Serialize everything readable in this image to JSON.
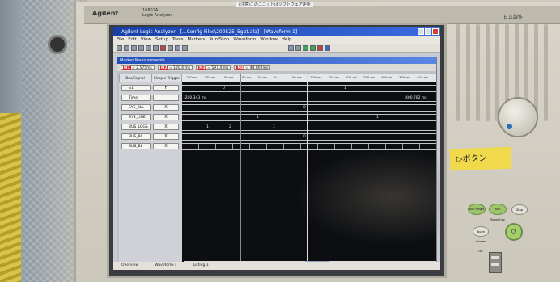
{
  "device": {
    "brand": "Agilent",
    "model_line1": "16802A",
    "model_line2": "Logic Analyzer",
    "maker_label": "日立製作",
    "top_sticker": "(注意)このユニットはソフトウェア更新"
  },
  "window": {
    "title": "Agilent Logic Analyzer - [...Config Files\\200525_5gpt.ala] - [Waveform-1]",
    "menu": [
      "File",
      "Edit",
      "View",
      "Setup",
      "Tools",
      "Markers",
      "Run/Stop",
      "Waveform",
      "Window",
      "Help"
    ]
  },
  "subwindow": {
    "title": "Marker Measurements",
    "markers": [
      {
        "id": "M1",
        "to": "M2",
        "value": "= 2.575ms"
      },
      {
        "id": "M2",
        "to": "M3",
        "value": "= 120.4 ms"
      },
      {
        "id": "M3",
        "to": "M4",
        "value": "= 597.4 ms"
      },
      {
        "id": "M4",
        "to": "M5",
        "value": "= 44.802ms"
      }
    ]
  },
  "panel": {
    "col_bus": "Bus/Signal",
    "col_trigger": "Simple Trigger"
  },
  "signals": [
    {
      "name": "S1",
      "trigger": "F",
      "wave": [
        "0",
        "",
        "1"
      ]
    },
    {
      "name": "Time",
      "trigger": "",
      "wave": [
        "-200.343 ms",
        "",
        "400.782 ms"
      ]
    },
    {
      "name": "SYS_BLL",
      "trigger": "X",
      "wave": [
        "",
        "0",
        ""
      ]
    },
    {
      "name": "SYS_LINE",
      "trigger": "X",
      "wave": [
        "",
        "1",
        "1"
      ]
    },
    {
      "name": "BUS_LOGS",
      "trigger": "X",
      "wave": [
        "1",
        "2",
        "1"
      ]
    },
    {
      "name": "BUS_BL",
      "trigger": "X",
      "wave": [
        "",
        "0",
        ""
      ]
    },
    {
      "name": "BUS_BL",
      "trigger": "X",
      "wave": [
        "",
        "",
        ""
      ]
    }
  ],
  "ruler_ticks": [
    "-250 ms",
    "-200 ms",
    "-150 ms",
    "-100 ms",
    "-50 ms",
    "0 s",
    "50 ms",
    "100 ms",
    "150 ms",
    "200 ms",
    "250 ms",
    "300 ms",
    "350 ms",
    "400 ms"
  ],
  "status": {
    "left": "Overview",
    "mid": "Waveform-1",
    "right": "Listing-1"
  },
  "front_panel": {
    "note_text": "▷ボタン",
    "buttons": [
      "Run Single",
      "Run Repetitive",
      "Stop",
      "Touch Screen Off"
    ]
  }
}
